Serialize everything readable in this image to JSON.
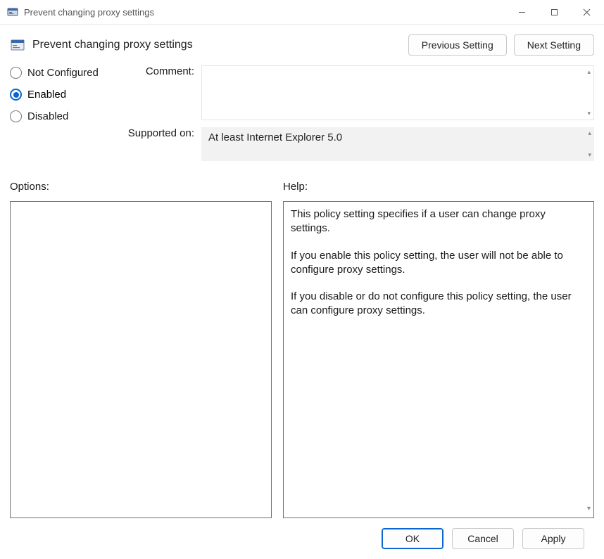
{
  "window": {
    "title": "Prevent changing proxy settings"
  },
  "header": {
    "policy_title": "Prevent changing proxy settings",
    "previous": "Previous Setting",
    "next": "Next Setting"
  },
  "state": {
    "options": {
      "not_configured": "Not Configured",
      "enabled": "Enabled",
      "disabled": "Disabled"
    },
    "selected": "enabled"
  },
  "labels": {
    "comment": "Comment:",
    "supported_on": "Supported on:",
    "options": "Options:",
    "help": "Help:"
  },
  "comment": "",
  "supported_on": "At least Internet Explorer 5.0",
  "help": {
    "p1": "This policy setting specifies if a user can change proxy settings.",
    "p2": "If you enable this policy setting, the user will not be able to configure proxy settings.",
    "p3": "If you disable or do not configure this policy setting, the user can configure proxy settings."
  },
  "buttons": {
    "ok": "OK",
    "cancel": "Cancel",
    "apply": "Apply"
  }
}
